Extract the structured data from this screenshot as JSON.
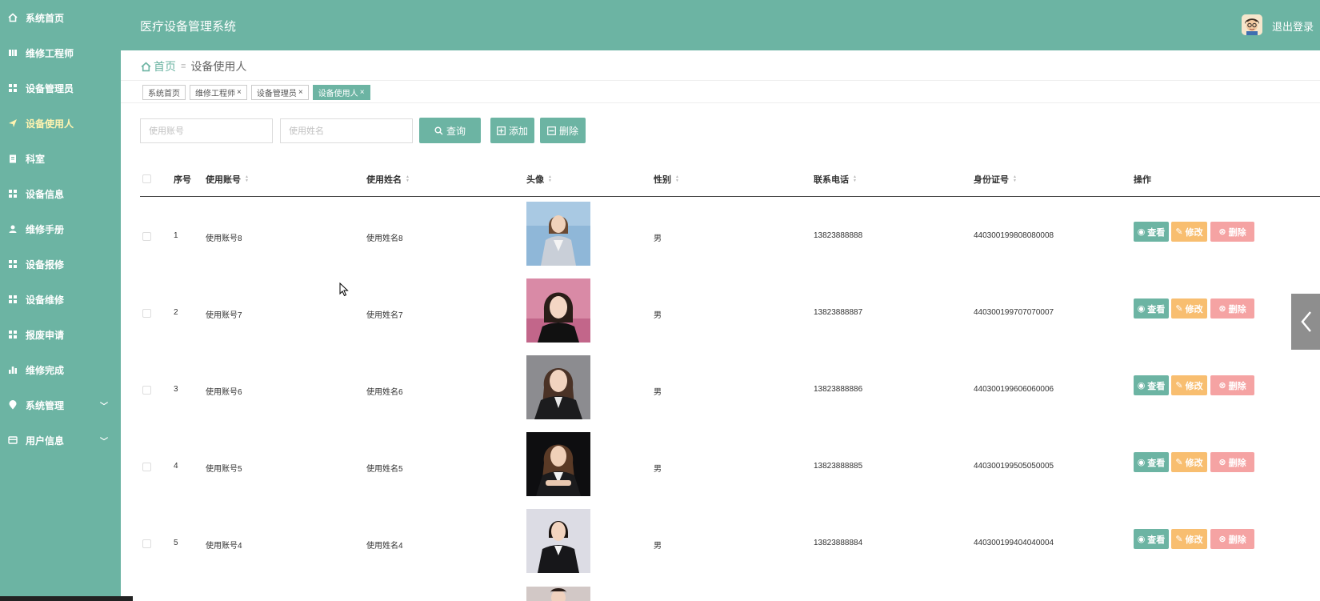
{
  "app": {
    "title": "医疗设备管理系统",
    "logout_label": "退出登录"
  },
  "colors": {
    "primary": "#6cb4a3",
    "warning": "#f8be70",
    "danger": "#f5a3a3",
    "sidebar_active_text": "#fff3b0"
  },
  "sidebar": {
    "items": [
      {
        "label": "系统首页",
        "icon": "home-icon"
      },
      {
        "label": "维修工程师",
        "icon": "book-icon"
      },
      {
        "label": "设备管理员",
        "icon": "grid-icon"
      },
      {
        "label": "设备使用人",
        "icon": "send-icon",
        "active": true
      },
      {
        "label": "科室",
        "icon": "clipboard-icon"
      },
      {
        "label": "设备信息",
        "icon": "grid-icon"
      },
      {
        "label": "维修手册",
        "icon": "user-icon"
      },
      {
        "label": "设备报修",
        "icon": "grid-icon"
      },
      {
        "label": "设备维修",
        "icon": "grid-icon"
      },
      {
        "label": "报废申请",
        "icon": "grid-icon"
      },
      {
        "label": "维修完成",
        "icon": "bar-chart-icon"
      },
      {
        "label": "系统管理",
        "icon": "location-icon",
        "expandable": true
      },
      {
        "label": "用户信息",
        "icon": "card-icon",
        "expandable": true
      }
    ]
  },
  "breadcrumb": {
    "home": "首页",
    "separator": "≡",
    "current": "设备使用人"
  },
  "tags": [
    {
      "label": "系统首页",
      "closable": false
    },
    {
      "label": "维修工程师",
      "closable": true
    },
    {
      "label": "设备管理员",
      "closable": true
    },
    {
      "label": "设备使用人",
      "closable": true,
      "active": true
    }
  ],
  "search": {
    "account_placeholder": "使用账号",
    "name_placeholder": "使用姓名",
    "query_label": "查询",
    "add_label": "添加",
    "delete_label": "删除"
  },
  "table": {
    "headers": {
      "index": "序号",
      "account": "使用账号",
      "name": "使用姓名",
      "avatar": "头像",
      "gender": "性别",
      "phone": "联系电话",
      "idcard": "身份证号",
      "actions": "操作"
    },
    "action_labels": {
      "view": "查看",
      "edit": "修改",
      "delete": "删除"
    },
    "rows": [
      {
        "index": "1",
        "account": "使用账号8",
        "name": "使用姓名8",
        "gender": "男",
        "phone": "13823888888",
        "idcard": "440300199808080008",
        "photo": "light-blue"
      },
      {
        "index": "2",
        "account": "使用账号7",
        "name": "使用姓名7",
        "gender": "男",
        "phone": "13823888887",
        "idcard": "440300199707070007",
        "photo": "pink"
      },
      {
        "index": "3",
        "account": "使用账号6",
        "name": "使用姓名6",
        "gender": "男",
        "phone": "13823888886",
        "idcard": "440300199606060006",
        "photo": "gray"
      },
      {
        "index": "4",
        "account": "使用账号5",
        "name": "使用姓名5",
        "gender": "男",
        "phone": "13823888885",
        "idcard": "440300199505050005",
        "photo": "dark"
      },
      {
        "index": "5",
        "account": "使用账号4",
        "name": "使用姓名4",
        "gender": "男",
        "phone": "13823888884",
        "idcard": "440300199404040004",
        "photo": "white"
      }
    ]
  }
}
